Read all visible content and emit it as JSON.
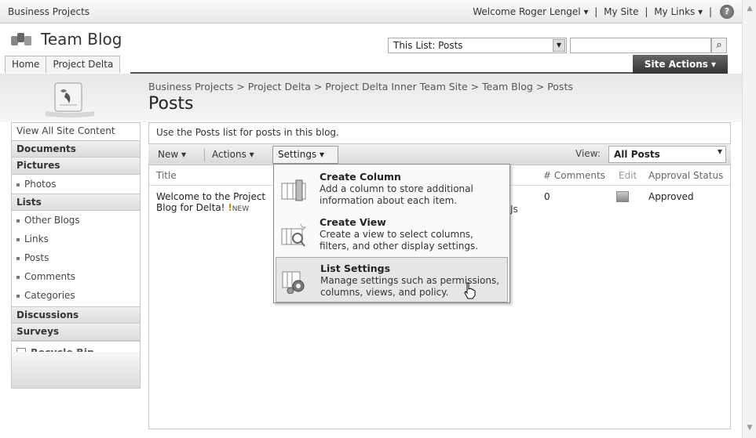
{
  "global_nav": {
    "site_name": "Business Projects",
    "welcome": "Welcome Roger Lengel ▾",
    "sep1": "|",
    "my_site": "My Site",
    "sep2": "|",
    "my_links": "My Links ▾",
    "sep3": "|",
    "help_glyph": "?"
  },
  "header": {
    "site_title": "Team Blog",
    "search_scope": "This List: Posts",
    "search_placeholder": "",
    "tabs": [
      "Home",
      "Project Delta"
    ],
    "site_actions": "Site Actions ▾"
  },
  "breadcrumb": "Business Projects > Project Delta > Project Delta Inner Team Site > Team Blog > Posts",
  "page_title": "Posts",
  "quick_launch": {
    "view_all": "View All Site Content",
    "documents": "Documents",
    "pictures": "Pictures",
    "pictures_items": [
      "Photos"
    ],
    "lists": "Lists",
    "lists_items": [
      "Other Blogs",
      "Links",
      "Posts",
      "Comments",
      "Categories"
    ],
    "discussions": "Discussions",
    "surveys": "Surveys",
    "recycle_bin": "Recycle Bin"
  },
  "list": {
    "description": "Use the Posts list for posts in this blog.",
    "toolbar": {
      "new": "New ▾",
      "actions": "Actions ▾",
      "settings": "Settings ▾",
      "view_label": "View:",
      "view_value": "All Posts"
    },
    "columns": {
      "title": "Title",
      "comments": "# Comments",
      "edit": "Edit",
      "approval": "Approval Status"
    },
    "row": {
      "title_line1": "Welcome to the Project",
      "title_line2": "Blog for Delta!",
      "new_badge": "NEW",
      "new_mark": "!",
      "comments": "0",
      "approval": "Approved",
      "obscured_fragment": "Js"
    }
  },
  "settings_menu": [
    {
      "title": "Create Column",
      "desc": "Add a column to store additional information about each item."
    },
    {
      "title": "Create View",
      "desc": "Create a view to select columns, filters, and other display settings."
    },
    {
      "title": "List Settings",
      "desc": "Manage settings such as permissions, columns, views, and policy."
    }
  ],
  "icons": {
    "logo": "people-group-icon",
    "help": "help-icon",
    "search": "magnifier-icon",
    "edit": "edit-document-icon",
    "recycle": "recycle-bin-icon",
    "create_column": "create-column-icon",
    "create_view": "create-view-icon",
    "list_settings": "list-settings-gear-icon",
    "cursor": "hand-pointer-icon"
  }
}
